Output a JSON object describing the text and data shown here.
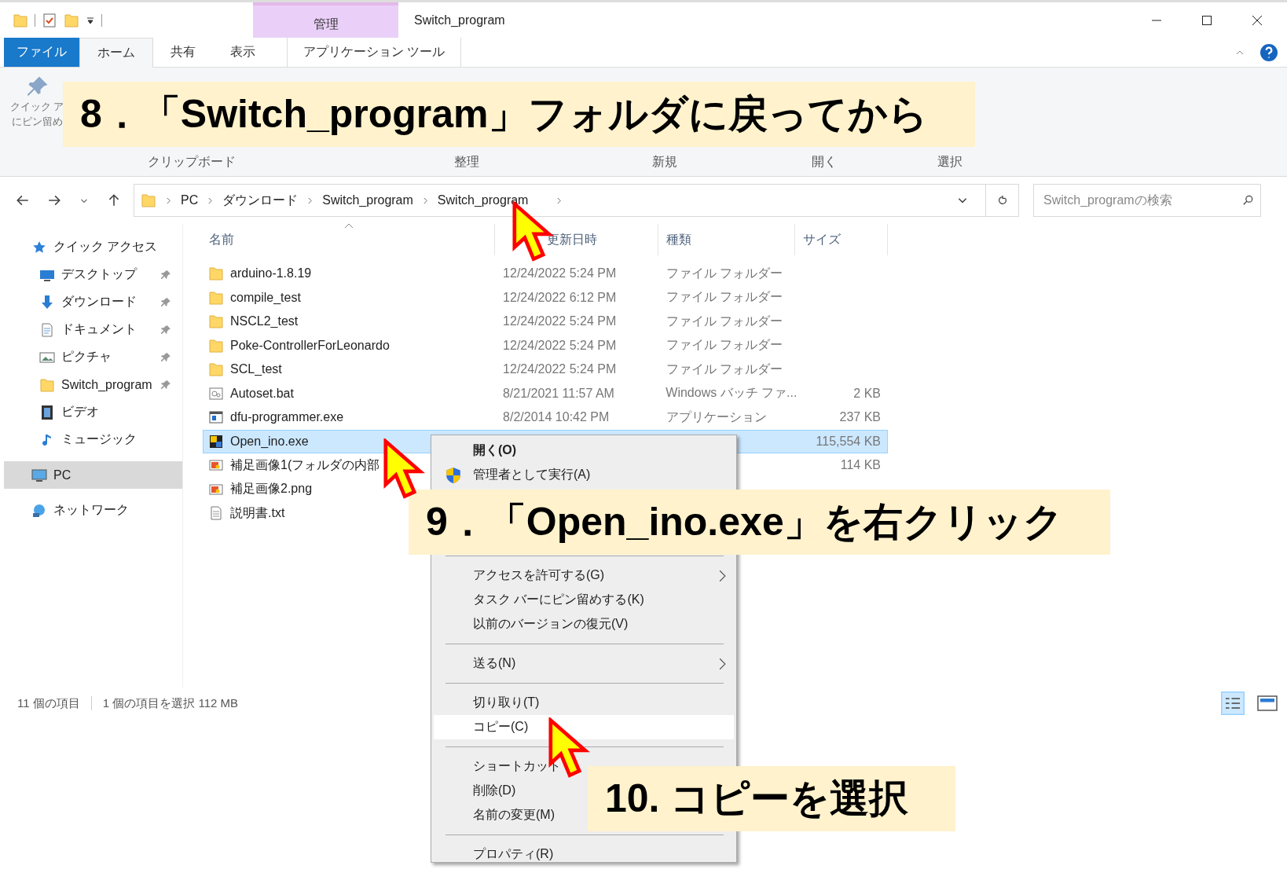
{
  "window": {
    "title": "Switch_program",
    "context_tab": "管理"
  },
  "ribbon_tabs": [
    {
      "label": "ファイル",
      "kind": "file",
      "selected": false
    },
    {
      "label": "ホーム",
      "kind": "tab",
      "selected": true
    },
    {
      "label": "共有",
      "kind": "tab",
      "selected": false
    },
    {
      "label": "表示",
      "kind": "tab",
      "selected": false
    },
    {
      "label": "アプリケーション ツール",
      "kind": "context",
      "selected": false
    }
  ],
  "ribbon": {
    "pin_label": [
      "クイック ア",
      "にピン留め"
    ],
    "groups": [
      "クリップボード",
      "整理",
      "新規",
      "開く",
      "選択"
    ]
  },
  "address": {
    "crumbs": [
      "PC",
      "ダウンロード",
      "Switch_program",
      "Switch_program"
    ]
  },
  "search": {
    "placeholder": "Switch_programの検索"
  },
  "sidebar": {
    "items": [
      {
        "label": "クイック アクセス",
        "kind": "star",
        "selected": false,
        "children": [
          {
            "label": "デスクトップ",
            "kind": "desktop",
            "pinned": true,
            "selected": false
          },
          {
            "label": "ダウンロード",
            "kind": "download",
            "pinned": true,
            "selected": false
          },
          {
            "label": "ドキュメント",
            "kind": "document",
            "pinned": true,
            "selected": false
          },
          {
            "label": "ピクチャ",
            "kind": "picture",
            "pinned": true,
            "selected": false
          },
          {
            "label": "Switch_program",
            "kind": "folder",
            "pinned": true,
            "selected": false
          },
          {
            "label": "ビデオ",
            "kind": "video",
            "pinned": false,
            "selected": false
          },
          {
            "label": "ミュージック",
            "kind": "music",
            "pinned": false,
            "selected": false
          }
        ]
      },
      {
        "label": "PC",
        "kind": "pc",
        "selected": true
      },
      {
        "label": "ネットワーク",
        "kind": "network",
        "selected": false
      }
    ]
  },
  "table": {
    "columns": [
      "名前",
      "更新日時",
      "種類",
      "サイズ"
    ],
    "rows": [
      {
        "name": "arduino-1.8.19",
        "kind": "folder",
        "date": "12/24/2022 5:24 PM",
        "type": "ファイル フォルダー",
        "selected": false
      },
      {
        "name": "compile_test",
        "kind": "folder",
        "date": "12/24/2022 6:12 PM",
        "type": "ファイル フォルダー",
        "selected": false
      },
      {
        "name": "NSCL2_test",
        "kind": "folder",
        "date": "12/24/2022 5:24 PM",
        "type": "ファイル フォルダー",
        "selected": false
      },
      {
        "name": "Poke-ControllerForLeonardo",
        "kind": "folder",
        "date": "12/24/2022 5:24 PM",
        "type": "ファイル フォルダー",
        "selected": false
      },
      {
        "name": "SCL_test",
        "kind": "folder",
        "date": "12/24/2022 5:24 PM",
        "type": "ファイル フォルダー",
        "selected": false
      },
      {
        "name": "Autoset.bat",
        "kind": "batch",
        "date": "8/21/2021 11:57 AM",
        "type": "Windows バッチ ファ...",
        "size": "2 KB",
        "selected": false
      },
      {
        "name": "dfu-programmer.exe",
        "kind": "program",
        "date": "8/2/2014 10:42 PM",
        "type": "アプリケーション",
        "size": "237 KB",
        "selected": false
      },
      {
        "name": "Open_ino.exe",
        "kind": "app",
        "size": "115,554 KB",
        "selected": true
      },
      {
        "name": "補足画像1(フォルダの内部",
        "kind": "image",
        "size": "114 KB",
        "selected": false
      },
      {
        "name": "補足画像2.png",
        "kind": "image",
        "selected": false
      },
      {
        "name": "説明書.txt",
        "kind": "text",
        "selected": false
      }
    ]
  },
  "status_bar": {
    "count": "11 個の項目",
    "selection": "1 個の項目を選択  112 MB"
  },
  "context_menu": {
    "items": [
      {
        "kind": "default",
        "label": "開く(O)",
        "selected": false
      },
      {
        "kind": "shield",
        "label": "管理者として実行(A)",
        "selected": false
      },
      {
        "kind": "hidden"
      },
      {
        "kind": "separator"
      },
      {
        "kind": "submenu",
        "label": "アクセスを許可する(G)",
        "selected": false
      },
      {
        "kind": "item",
        "label": "タスク バーにピン留めする(K)",
        "selected": false
      },
      {
        "kind": "item",
        "label": "以前のバージョンの復元(V)",
        "selected": false
      },
      {
        "kind": "separator"
      },
      {
        "kind": "submenu",
        "label": "送る(N)",
        "selected": false
      },
      {
        "kind": "separator"
      },
      {
        "kind": "item",
        "label": "切り取り(T)",
        "selected": false
      },
      {
        "kind": "item",
        "label": "コピー(C)",
        "selected": true
      },
      {
        "kind": "separator"
      },
      {
        "kind": "item",
        "label": "ショートカット",
        "selected": false
      },
      {
        "kind": "item",
        "label": "削除(D)",
        "selected": false
      },
      {
        "kind": "item",
        "label": "名前の変更(M)",
        "selected": false
      },
      {
        "kind": "separator"
      },
      {
        "kind": "item",
        "label": "プロパティ(R)",
        "selected": false
      }
    ]
  },
  "callouts": [
    {
      "text": "8．「Switch_program」フォルダに戻ってから"
    },
    {
      "text": "9．「Open_ino.exe」を右クリック"
    },
    {
      "text": "10.  コピーを選択"
    }
  ]
}
